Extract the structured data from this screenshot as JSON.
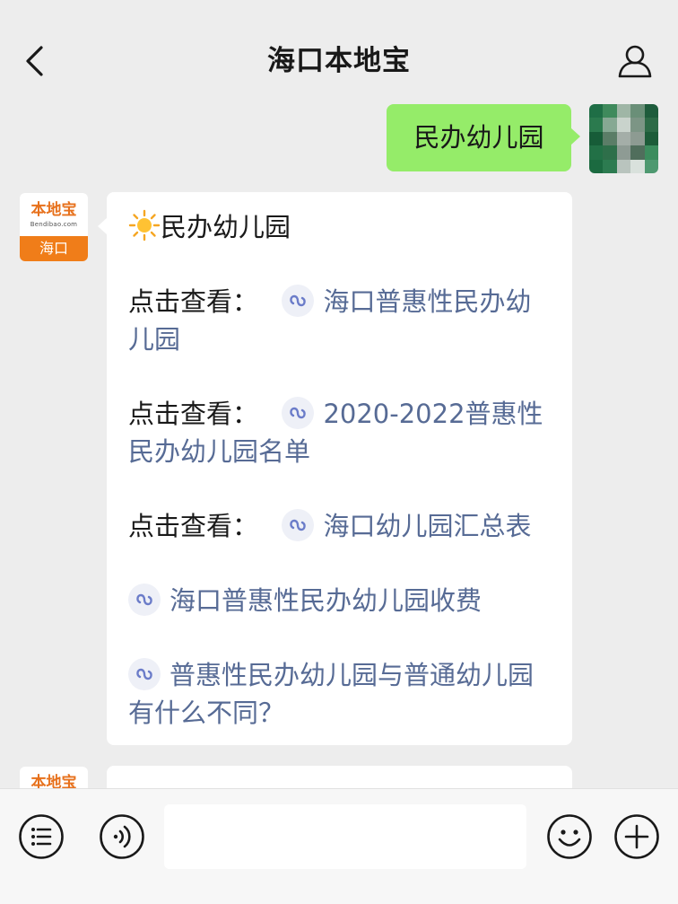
{
  "header": {
    "title": "海口本地宝",
    "back_icon": "chevron-left-icon",
    "profile_icon": "person-icon"
  },
  "user_message": {
    "text": "民办幼儿园"
  },
  "bot": {
    "avatar": {
      "logo_text": "本地宝",
      "domain_text": "Bendibao.com",
      "city_text": "海口"
    },
    "message": {
      "title_icon": "sun-icon",
      "title": "民办幼儿园",
      "items": [
        {
          "prefix": "点击查看：",
          "link": "海口普惠性民办幼儿园"
        },
        {
          "prefix": "点击查看：",
          "link": "2020-2022普惠性民办幼儿园名单"
        },
        {
          "prefix": "点击查看：",
          "link": "海口幼儿园汇总表"
        },
        {
          "prefix": "",
          "link": "海口普惠性民办幼儿园收费"
        },
        {
          "prefix": "",
          "link": "普惠性民办幼儿园与普通幼儿园有什么不同？"
        }
      ],
      "link_icon": "mini-program-link-icon"
    }
  },
  "input_bar": {
    "menu_icon": "list-menu-icon",
    "voice_icon": "voice-icon",
    "emoji_icon": "emoji-icon",
    "plus_icon": "plus-icon",
    "placeholder": ""
  },
  "colors": {
    "background": "#ededed",
    "user_bubble": "#95ec69",
    "link": "#576b95",
    "brand_orange": "#f07d19"
  }
}
